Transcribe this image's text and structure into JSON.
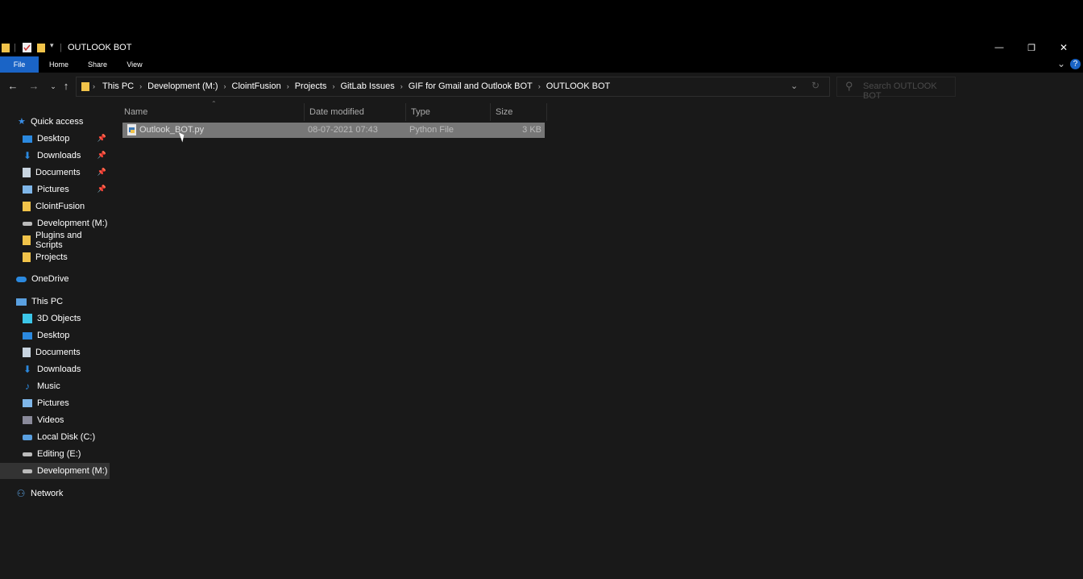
{
  "window": {
    "title": "OUTLOOK BOT",
    "controls": {
      "minimize": "—",
      "maximize": "❐",
      "close": "✕"
    }
  },
  "ribbon": {
    "tabs": [
      {
        "label": "File"
      },
      {
        "label": "Home"
      },
      {
        "label": "Share"
      },
      {
        "label": "View"
      }
    ],
    "help": "?",
    "expand": "⌄"
  },
  "address": {
    "crumbs": [
      "This PC",
      "Development (M:)",
      "ClointFusion",
      "Projects",
      "GitLab Issues",
      "GIF for Gmail and Outlook BOT",
      "OUTLOOK BOT"
    ],
    "separator": "›",
    "dropdown": "⌄",
    "refresh": "↻"
  },
  "search": {
    "placeholder": "Search OUTLOOK BOT",
    "icon": "⚲"
  },
  "nav": {
    "quick_access": "Quick access",
    "quick_items": [
      {
        "label": "Desktop",
        "icon": "desktop-icon",
        "pinned": true
      },
      {
        "label": "Downloads",
        "icon": "download-icon",
        "pinned": true
      },
      {
        "label": "Documents",
        "icon": "document-icon",
        "pinned": true
      },
      {
        "label": "Pictures",
        "icon": "picture-icon",
        "pinned": true
      },
      {
        "label": "ClointFusion",
        "icon": "folder-icon",
        "pinned": false
      },
      {
        "label": "Development (M:)",
        "icon": "drive-icon",
        "pinned": false
      },
      {
        "label": "Plugins and Scripts",
        "icon": "folder-icon",
        "pinned": false
      },
      {
        "label": "Projects",
        "icon": "folder-icon",
        "pinned": false
      }
    ],
    "onedrive": "OneDrive",
    "this_pc": "This PC",
    "pc_items": [
      {
        "label": "3D Objects",
        "icon": "cube-icon"
      },
      {
        "label": "Desktop",
        "icon": "desktop-icon"
      },
      {
        "label": "Documents",
        "icon": "document-icon"
      },
      {
        "label": "Downloads",
        "icon": "download-icon"
      },
      {
        "label": "Music",
        "icon": "music-icon"
      },
      {
        "label": "Pictures",
        "icon": "picture-icon"
      },
      {
        "label": "Videos",
        "icon": "video-icon"
      },
      {
        "label": "Local Disk (C:)",
        "icon": "drive-icon"
      },
      {
        "label": "Editing (E:)",
        "icon": "drive-icon"
      },
      {
        "label": "Development (M:)",
        "icon": "drive-icon",
        "selected": true
      }
    ],
    "network": "Network"
  },
  "files": {
    "columns": [
      "Name",
      "Date modified",
      "Type",
      "Size"
    ],
    "rows": [
      {
        "name": "Outlook_BOT.py",
        "date": "08-07-2021 07:43",
        "type": "Python File",
        "size": "3 KB"
      }
    ]
  },
  "colors": {
    "accent": "#1a64c6",
    "folder": "#f1c34a",
    "background": "#191919"
  }
}
